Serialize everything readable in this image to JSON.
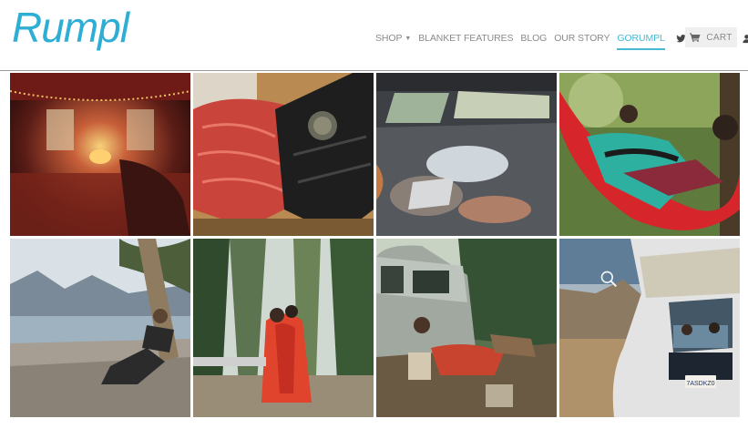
{
  "brand": {
    "logo_text": "Rumpl",
    "logo_color": "#2eaed4"
  },
  "nav": {
    "shop": "SHOP",
    "blanket_features": "BLANKET FEATURES",
    "blog": "BLOG",
    "our_story": "OUR STORY",
    "gorumpl": "GORUMPL",
    "active_item": "GORUMPL",
    "active_color": "#49b9d2"
  },
  "social": {
    "icons": [
      "twitter-icon",
      "facebook-icon",
      "pinterest-icon",
      "instagram-icon",
      "account-icon"
    ]
  },
  "cart": {
    "label": "CART",
    "icon": "cart-icon"
  },
  "gallery": {
    "tiles": [
      {
        "id": "van-interior-lights"
      },
      {
        "id": "red-blanket-camp-stove"
      },
      {
        "id": "car-trunk-sleepers"
      },
      {
        "id": "red-hammock-couple"
      },
      {
        "id": "lakeshore-hiker-tree"
      },
      {
        "id": "couple-red-blanket-forest"
      },
      {
        "id": "vw-van-campsite"
      },
      {
        "id": "van-rear-view"
      }
    ],
    "zoom_icon": "magnifier-icon"
  },
  "license_plate": "7ASDKZ0"
}
